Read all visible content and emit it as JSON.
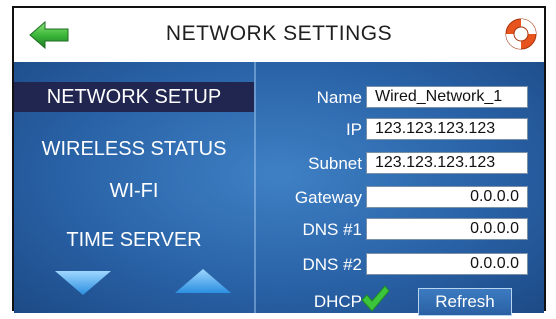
{
  "header": {
    "title": "NETWORK SETTINGS",
    "back_icon": "back-arrow-icon",
    "help_icon": "lifebuoy-help-icon"
  },
  "sidebar": {
    "items": [
      {
        "label": "NETWORK SETUP",
        "active": true
      },
      {
        "label": "WIRELESS STATUS",
        "active": false
      },
      {
        "label": "WI-FI",
        "active": false
      },
      {
        "label": "TIME SERVER",
        "active": false
      }
    ],
    "scroll_down_icon": "triangle-down-icon",
    "scroll_up_icon": "triangle-up-icon"
  },
  "form": {
    "name": {
      "label": "Name",
      "value": "Wired_Network_1"
    },
    "ip": {
      "label": "IP",
      "value": "123.123.123.123"
    },
    "subnet": {
      "label": "Subnet",
      "value": "123.123.123.123"
    },
    "gateway": {
      "label": "Gateway",
      "value": "0.0.0.0"
    },
    "dns1": {
      "label": "DNS #1",
      "value": "0.0.0.0"
    },
    "dns2": {
      "label": "DNS #2",
      "value": "0.0.0.0"
    },
    "dhcp": {
      "label": "DHCP",
      "checked": true,
      "check_icon": "checkmark-icon"
    },
    "refresh_label": "Refresh"
  },
  "colors": {
    "panel_blue": "#2a63a8",
    "active_item": "#202650",
    "back_arrow_green": "#2fa83a",
    "check_green": "#3cc43c",
    "help_orange": "#e8541e"
  }
}
